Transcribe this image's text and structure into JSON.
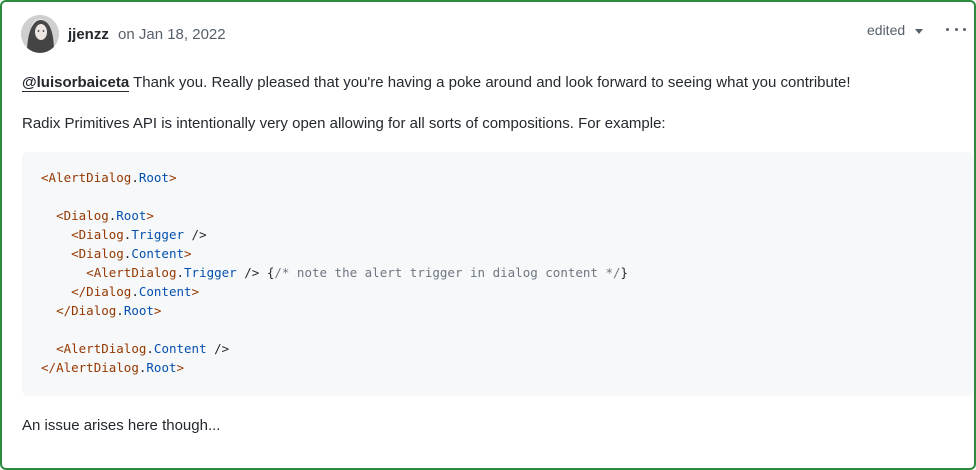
{
  "comment": {
    "author": "jjenzz",
    "timestamp": "on Jan 18, 2022",
    "edited_label": "edited",
    "paragraphs": {
      "p1_mention": "@luisorbaiceta",
      "p1_text": " Thank you. Really pleased that you're having a poke around and look forward to seeing what you contribute!",
      "p2": "Radix Primitives API is intentionally very open allowing for all sorts of compositions. For example:",
      "p3": "An issue arises here though..."
    },
    "code": {
      "l1": {
        "open": "<",
        "tag": "AlertDialog",
        "dot": ".",
        "prop": "Root",
        "close": ">"
      },
      "l2": {
        "indent": "  ",
        "open": "<",
        "tag": "Dialog",
        "dot": ".",
        "prop": "Root",
        "close": ">"
      },
      "l3": {
        "indent": "    ",
        "open": "<",
        "tag": "Dialog",
        "dot": ".",
        "prop": "Trigger",
        "close": " />"
      },
      "l4": {
        "indent": "    ",
        "open": "<",
        "tag": "Dialog",
        "dot": ".",
        "prop": "Content",
        "close": ">"
      },
      "l5": {
        "indent": "      ",
        "open": "<",
        "tag": "AlertDialog",
        "dot": ".",
        "prop": "Trigger",
        "close": " /> ",
        "brace_open": "{",
        "comment": "/* note the alert trigger in dialog content */",
        "brace_close": "}"
      },
      "l6": {
        "indent": "    ",
        "open": "</",
        "tag": "Dialog",
        "dot": ".",
        "prop": "Content",
        "close": ">"
      },
      "l7": {
        "indent": "  ",
        "open": "</",
        "tag": "Dialog",
        "dot": ".",
        "prop": "Root",
        "close": ">"
      },
      "l8": {
        "indent": "  ",
        "open": "<",
        "tag": "AlertDialog",
        "dot": ".",
        "prop": "Content",
        "close": " />"
      },
      "l9": {
        "open": "</",
        "tag": "AlertDialog",
        "dot": ".",
        "prop": "Root",
        "close": ">"
      }
    }
  },
  "icons": {
    "avatar": "user-avatar",
    "edited_caret": "caret-down-icon",
    "more": "kebab-horizontal-icon"
  },
  "colors": {
    "border": "#2d8a3e",
    "code_bg": "#f6f8fa",
    "tag": "#953800",
    "prop": "#0550ae",
    "comment": "#6e7781"
  }
}
